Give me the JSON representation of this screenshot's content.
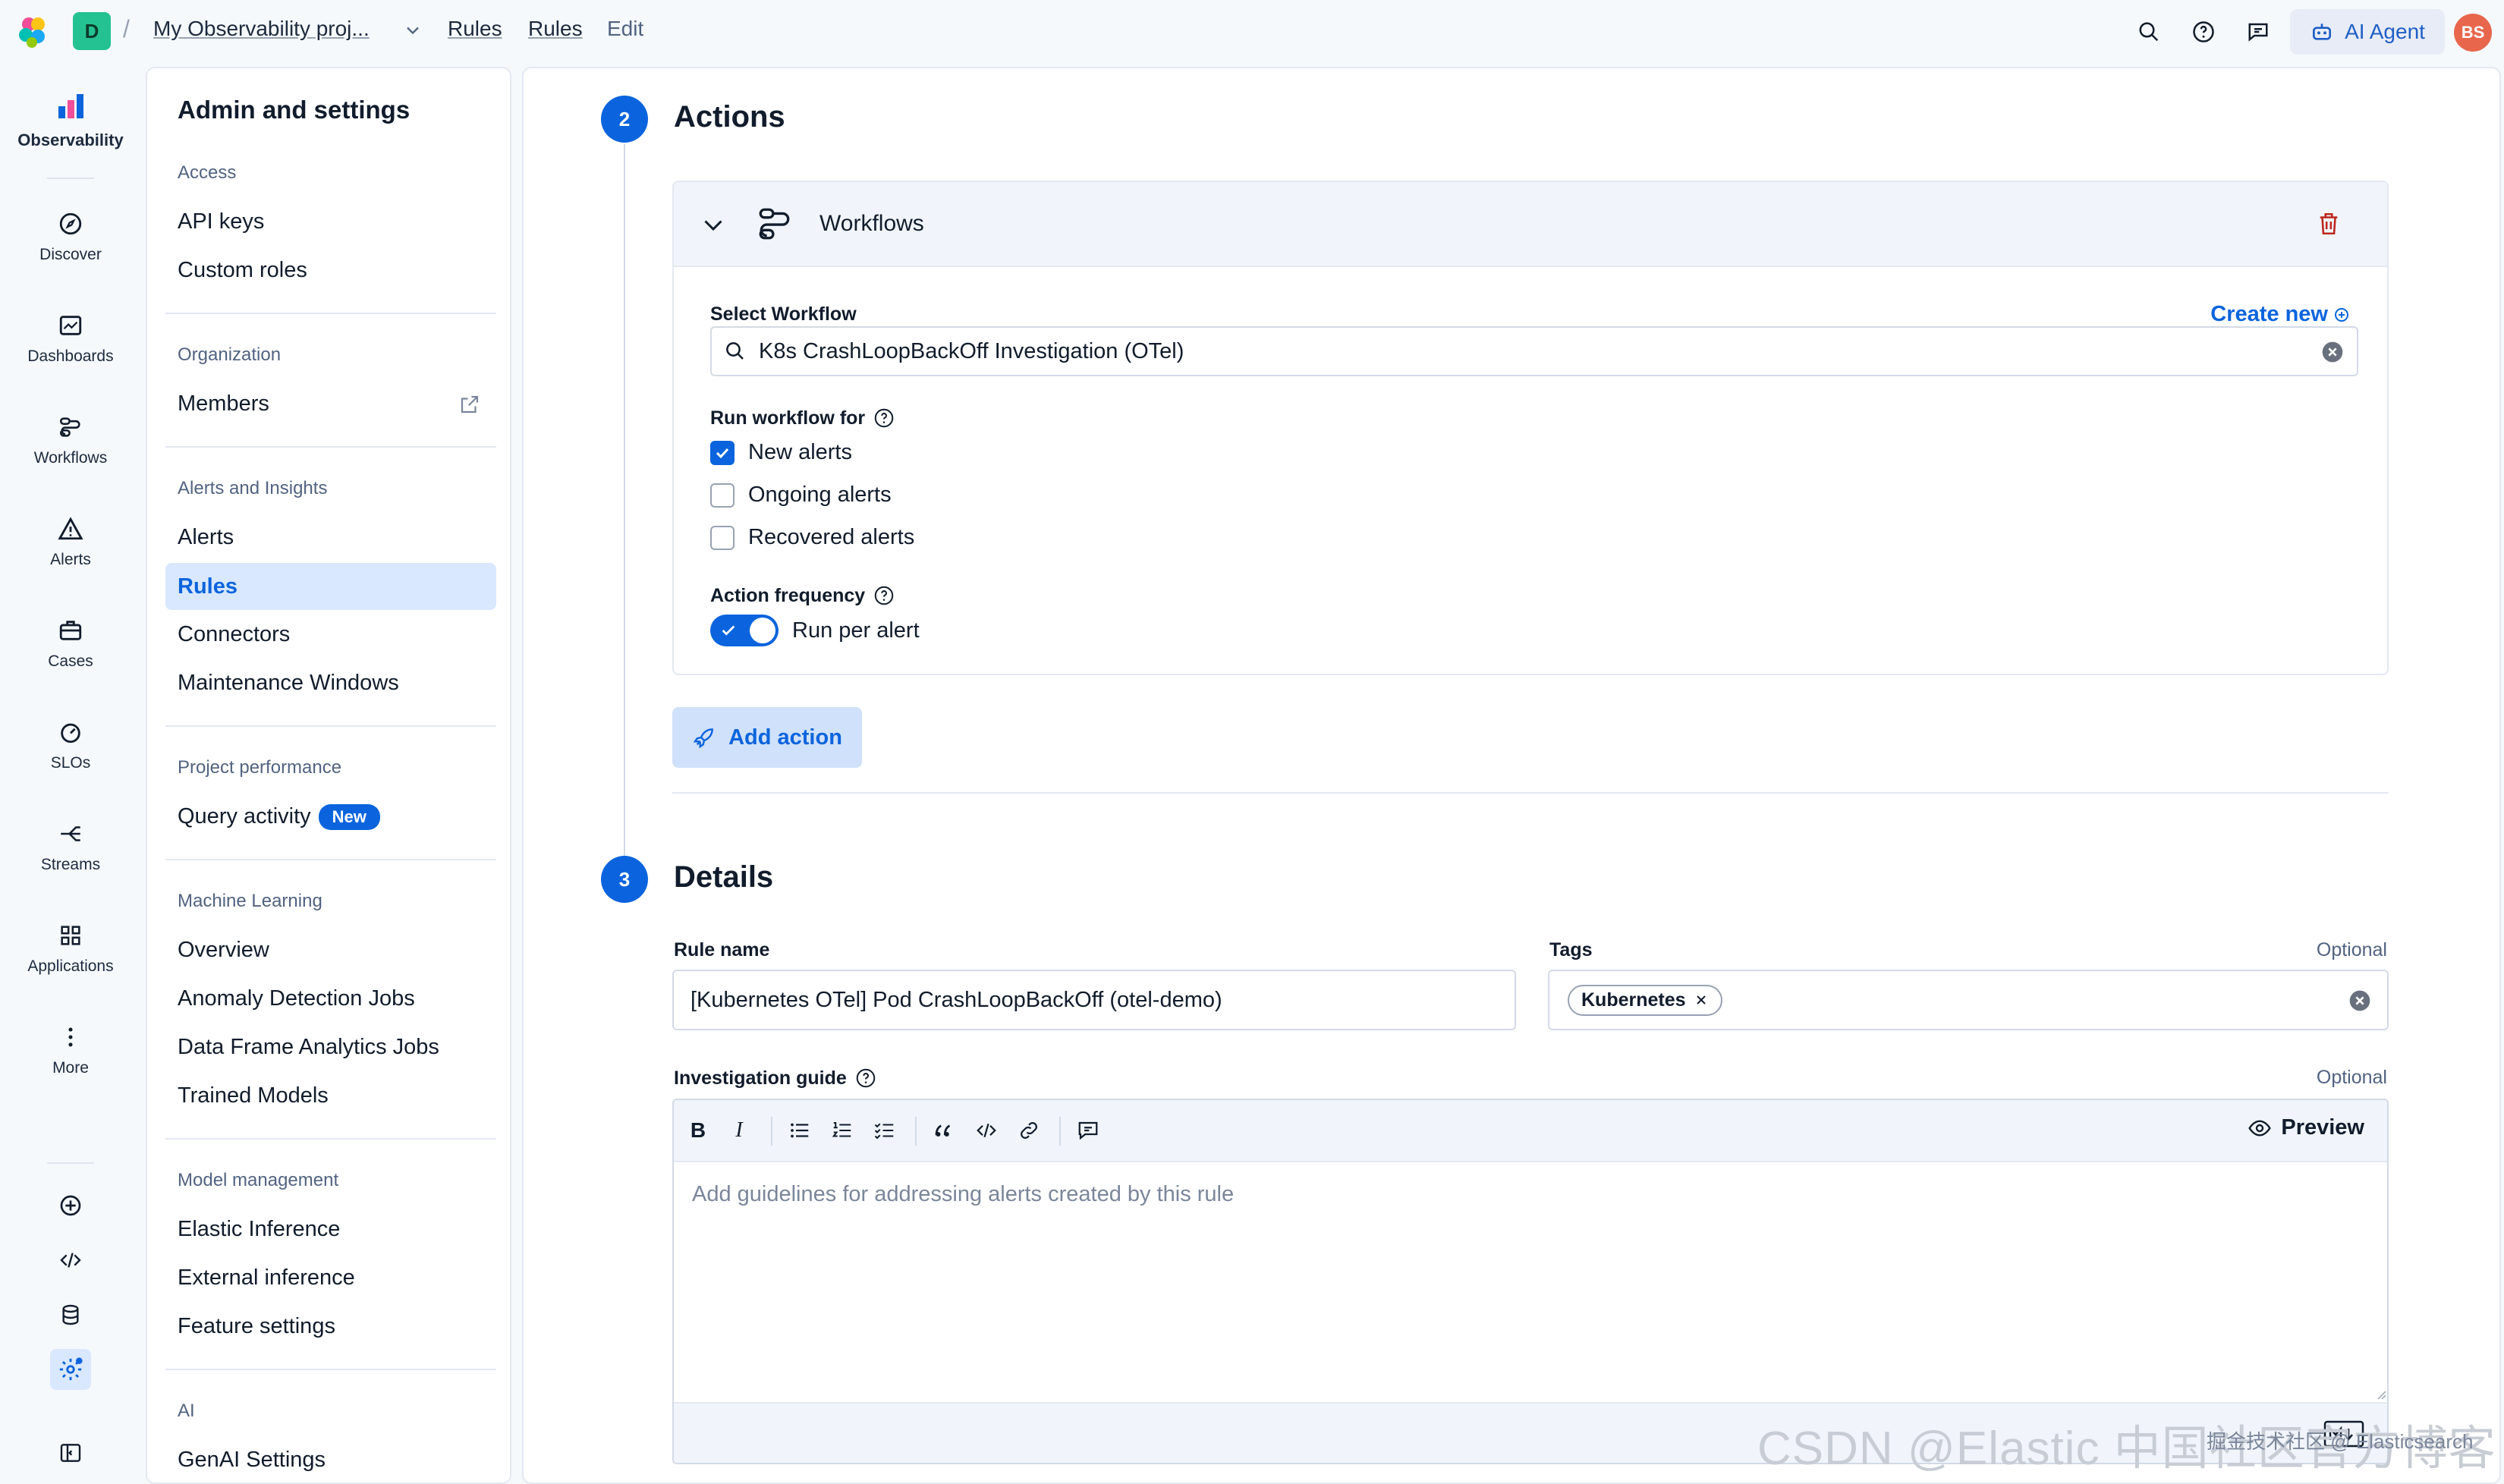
{
  "topbar": {
    "space_initial": "D",
    "breadcrumbs": [
      "My Observability proj...",
      "Rules",
      "Rules",
      "Edit"
    ],
    "ai_agent_label": "AI Agent",
    "avatar_initials": "BS"
  },
  "rail": {
    "brand_label": "Observability",
    "items": [
      {
        "label": "Discover",
        "icon": "compass-icon"
      },
      {
        "label": "Dashboards",
        "icon": "dashboard-icon"
      },
      {
        "label": "Workflows",
        "icon": "workflow-icon"
      },
      {
        "label": "Alerts",
        "icon": "warning-icon"
      },
      {
        "label": "Cases",
        "icon": "briefcase-icon"
      },
      {
        "label": "SLOs",
        "icon": "gauge-icon"
      },
      {
        "label": "Streams",
        "icon": "streams-icon"
      },
      {
        "label": "Applications",
        "icon": "apps-grid-icon"
      },
      {
        "label": "More",
        "icon": "more-vertical-icon"
      }
    ]
  },
  "nav": {
    "title": "Admin and settings",
    "groups": [
      {
        "label": "Access",
        "items": [
          "API keys",
          "Custom roles"
        ]
      },
      {
        "label": "Organization",
        "items": [
          "Members"
        ]
      },
      {
        "label": "Alerts and Insights",
        "items": [
          "Alerts",
          "Rules",
          "Connectors",
          "Maintenance Windows"
        ]
      },
      {
        "label": "Project performance",
        "items": [
          "Query activity"
        ]
      },
      {
        "label": "Machine Learning",
        "items": [
          "Overview",
          "Anomaly Detection Jobs",
          "Data Frame Analytics Jobs",
          "Trained Models"
        ]
      },
      {
        "label": "Model management",
        "items": [
          "Elastic Inference",
          "External inference",
          "Feature settings"
        ]
      },
      {
        "label": "AI",
        "items": [
          "GenAI Settings"
        ]
      }
    ],
    "active_item": "Rules",
    "new_badge": "New"
  },
  "actions": {
    "step": "2",
    "title": "Actions",
    "workflow_card_title": "Workflows",
    "select_workflow_label": "Select Workflow",
    "create_new_label": "Create new",
    "selected_workflow": "K8s CrashLoopBackOff Investigation (OTel)",
    "run_for_label": "Run workflow for",
    "run_for_options": [
      {
        "label": "New alerts",
        "checked": true
      },
      {
        "label": "Ongoing alerts",
        "checked": false
      },
      {
        "label": "Recovered alerts",
        "checked": false
      }
    ],
    "frequency_label": "Action frequency",
    "frequency_toggle_label": "Run per alert",
    "frequency_on": true,
    "add_action_label": "Add action"
  },
  "details": {
    "step": "3",
    "title": "Details",
    "rule_name_label": "Rule name",
    "rule_name_value": "[Kubernetes OTel] Pod CrashLoopBackOff (otel-demo)",
    "tags_label": "Tags",
    "tags_optional": "Optional",
    "tags": [
      "Kubernetes"
    ],
    "guide_label": "Investigation guide",
    "guide_optional": "Optional",
    "guide_placeholder": "Add guidelines for addressing alerts created by this rule",
    "preview_label": "Preview",
    "toolbar": {
      "bold": "B",
      "italic": "I"
    }
  },
  "watermark": {
    "main": "CSDN @Elastic 中国社区官方博客",
    "secondary": "掘金技术社区 @ Elasticsearch"
  },
  "colors": {
    "accent": "#0b64dd",
    "active_bg": "#d9e8ff",
    "danger": "#bd271e",
    "space_badge": "#24c292",
    "avatar": "#e7664c"
  }
}
